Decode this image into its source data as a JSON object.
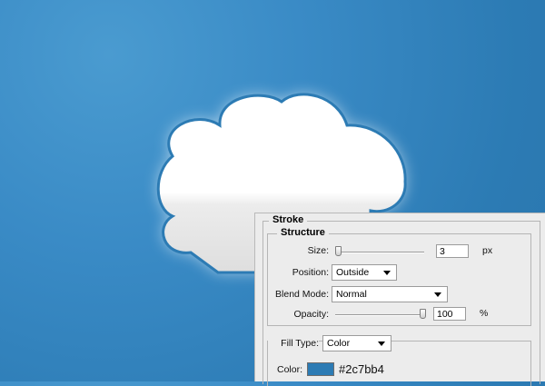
{
  "stroke_panel": {
    "title": "Stroke",
    "structure": {
      "title": "Structure",
      "size": {
        "label": "Size:",
        "value": "3",
        "unit": "px"
      },
      "position": {
        "label": "Position:",
        "value": "Outside"
      },
      "blend_mode": {
        "label": "Blend Mode:",
        "value": "Normal"
      },
      "opacity": {
        "label": "Opacity:",
        "value": "100",
        "unit": "%"
      }
    },
    "fill": {
      "type_label": "Fill Type:",
      "type_value": "Color",
      "color_label": "Color:",
      "color_hex": "#2c7bb4"
    }
  },
  "colors": {
    "background": "#2c7bb4",
    "stroke": "#2c7bb4",
    "panel": "#ececec"
  },
  "icons": [
    "cloud-shape",
    "chevron-down-icon"
  ]
}
